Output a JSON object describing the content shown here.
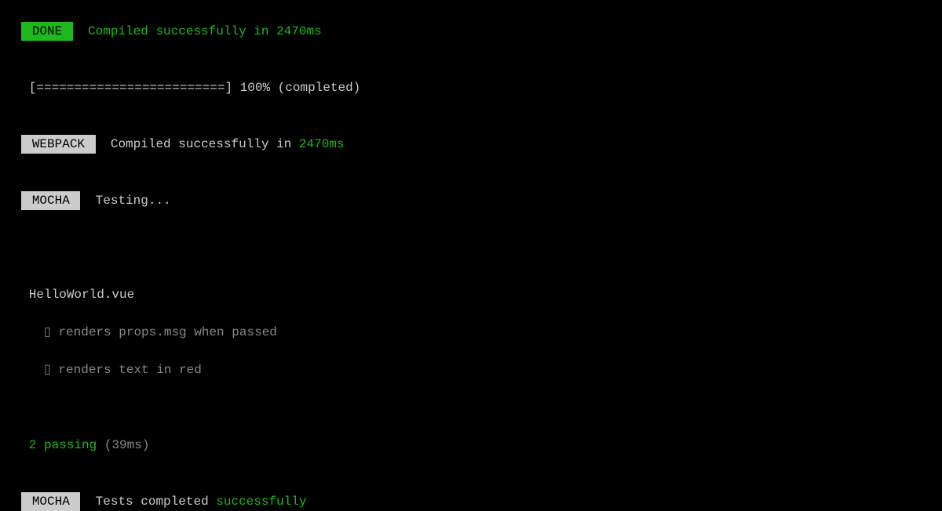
{
  "line0": {
    "badge": "DONE",
    "text_a": "Compiled successfully in ",
    "time": "2470ms"
  },
  "line2": {
    "bar": " [=========================] ",
    "pct": "100%",
    "status": " (completed)"
  },
  "line4": {
    "badge": "WEBPACK",
    "text_a": "  Compiled successfully in ",
    "time": "2470ms"
  },
  "line6": {
    "badge": "MOCHA",
    "text": "  Testing..."
  },
  "suite_name": " HelloWorld.vue",
  "tests": [
    {
      "mark": "   ▯ ",
      "name": "renders props.msg when passed"
    },
    {
      "mark": "   ▯ ",
      "name": "renders text in red"
    }
  ],
  "summary": {
    "text_a": " 2 passing ",
    "duration": "(39ms)"
  },
  "final": {
    "badge": "MOCHA",
    "text_a": "  Tests completed ",
    "status": "successfully"
  }
}
